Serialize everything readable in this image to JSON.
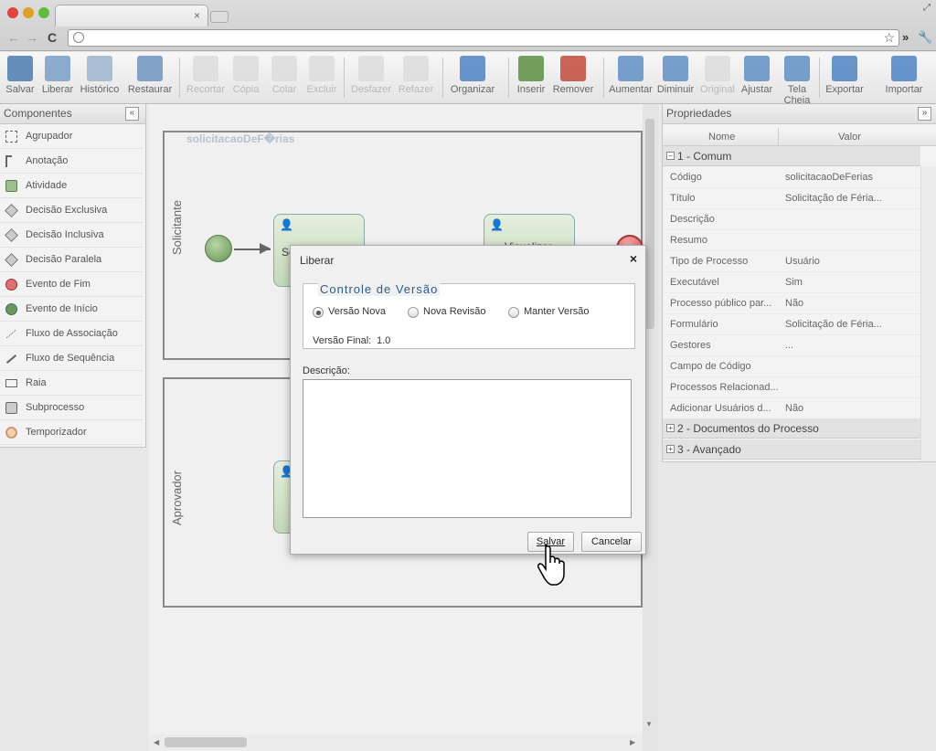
{
  "browser": {
    "tab_close": "×",
    "nav_back": "←",
    "nav_forward": "→",
    "reload": "C",
    "more": "»"
  },
  "toolbar": [
    {
      "label": "Salvar",
      "icon": "save-icon",
      "enabled": true
    },
    {
      "label": "Liberar",
      "icon": "release-icon",
      "enabled": true
    },
    {
      "label": "Histórico",
      "icon": "history-icon",
      "enabled": true
    },
    {
      "label": "Restaurar",
      "icon": "restore-icon",
      "enabled": true
    },
    {
      "label": "Recortar",
      "icon": "cut-icon",
      "enabled": false
    },
    {
      "label": "Cópia",
      "icon": "copy-icon",
      "enabled": false
    },
    {
      "label": "Colar",
      "icon": "paste-icon",
      "enabled": false
    },
    {
      "label": "Excluir",
      "icon": "delete-icon",
      "enabled": false
    },
    {
      "label": "Desfazer",
      "icon": "undo-icon",
      "enabled": false
    },
    {
      "label": "Refazer",
      "icon": "redo-icon",
      "enabled": false
    },
    {
      "label": "Organizar",
      "icon": "organize-icon",
      "enabled": true
    },
    {
      "label": "Inserir",
      "icon": "insert-icon",
      "enabled": true
    },
    {
      "label": "Remover",
      "icon": "remove-icon",
      "enabled": true
    },
    {
      "label": "Aumentar",
      "icon": "zoom-in-icon",
      "enabled": true
    },
    {
      "label": "Diminuir",
      "icon": "zoom-out-icon",
      "enabled": true
    },
    {
      "label": "Original",
      "icon": "zoom-original-icon",
      "enabled": false
    },
    {
      "label": "Ajustar",
      "icon": "zoom-fit-icon",
      "enabled": true
    },
    {
      "label": "Tela Cheia",
      "icon": "fullscreen-icon",
      "enabled": true
    },
    {
      "label": "Exportar",
      "icon": "export-icon",
      "enabled": true
    },
    {
      "label": "Importar",
      "icon": "import-icon",
      "enabled": true
    }
  ],
  "components": {
    "title": "Componentes",
    "collapse": "«",
    "items": [
      {
        "label": "Agrupador",
        "icon": "group-icon"
      },
      {
        "label": "Anotação",
        "icon": "annotation-icon"
      },
      {
        "label": "Atividade",
        "icon": "activity-icon"
      },
      {
        "label": "Decisão Exclusiva",
        "icon": "exclusive-gateway-icon"
      },
      {
        "label": "Decisão Inclusiva",
        "icon": "inclusive-gateway-icon"
      },
      {
        "label": "Decisão Paralela",
        "icon": "parallel-gateway-icon"
      },
      {
        "label": "Evento de Fim",
        "icon": "end-event-icon"
      },
      {
        "label": "Evento de Início",
        "icon": "start-event-icon"
      },
      {
        "label": "Fluxo de Associação",
        "icon": "association-flow-icon"
      },
      {
        "label": "Fluxo de Sequência",
        "icon": "sequence-flow-icon"
      },
      {
        "label": "Raia",
        "icon": "lane-icon"
      },
      {
        "label": "Subprocesso",
        "icon": "subprocess-icon"
      },
      {
        "label": "Temporizador",
        "icon": "timer-icon"
      }
    ]
  },
  "canvas": {
    "process_name": "solicitacaoDeF�rias",
    "lane1": "Solicitante",
    "lane2": "Aprovador",
    "task1": "So",
    "task2": "Visualizar"
  },
  "properties": {
    "title": "Propriedades",
    "collapse": "»",
    "col_name": "Nome",
    "col_value": "Valor",
    "section1": "1 - Comum",
    "section2": "2 - Documentos do Processo",
    "section3": "3 - Avançado",
    "rows": [
      {
        "key": "Código",
        "value": "solicitacaoDeFerias"
      },
      {
        "key": "Título",
        "value": "Solicitação de Féria..."
      },
      {
        "key": "Descrição",
        "value": ""
      },
      {
        "key": "Resumo",
        "value": ""
      },
      {
        "key": "Tipo de Processo",
        "value": "Usuário"
      },
      {
        "key": "Executável",
        "value": "Sim"
      },
      {
        "key": "Processo público par...",
        "value": "Não"
      },
      {
        "key": "Formulário",
        "value": "Solicitação de Féria..."
      },
      {
        "key": "Gestores",
        "value": "..."
      },
      {
        "key": "Campo de Código",
        "value": ""
      },
      {
        "key": "Processos Relacionad...",
        "value": ""
      },
      {
        "key": "Adicionar Usuários d...",
        "value": "Não"
      }
    ]
  },
  "dialog": {
    "title": "Liberar",
    "close": "×",
    "legend": "Controle de Versão",
    "options": [
      "Versão Nova",
      "Nova Revisão",
      "Manter Versão"
    ],
    "selected": "Versão Nova",
    "final_version_label": "Versão Final:",
    "final_version_value": "1.0",
    "description_label": "Descrição:",
    "description_value": "",
    "save": "Salvar",
    "cancel": "Cancelar"
  }
}
